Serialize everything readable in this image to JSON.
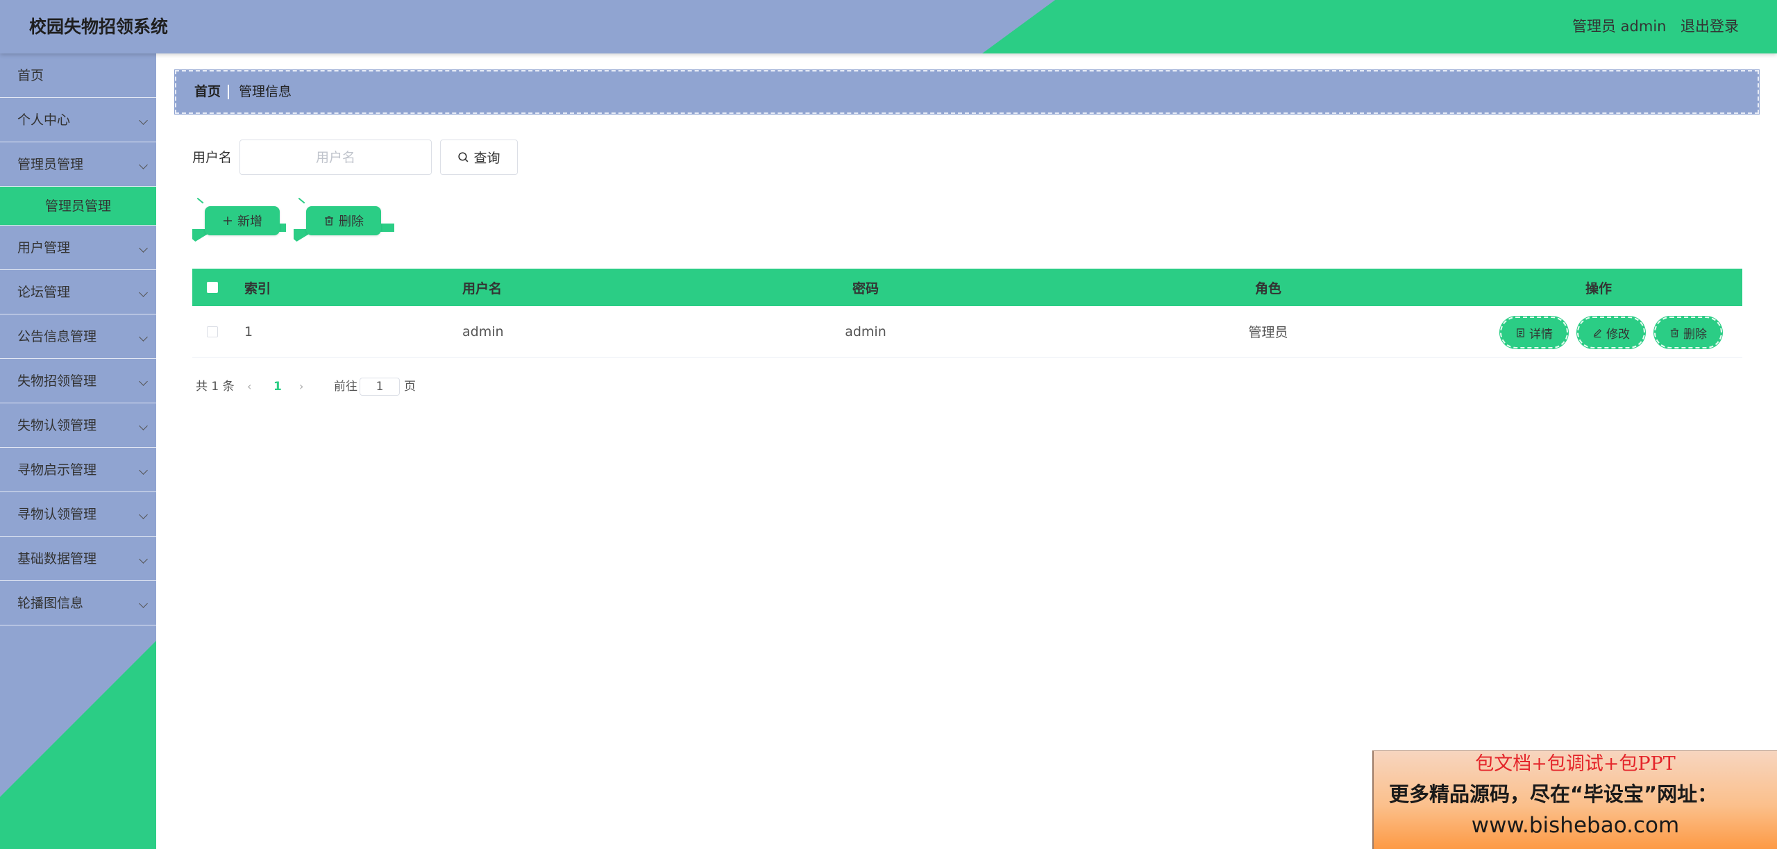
{
  "header": {
    "title": "校园失物招领系统",
    "user_label": "管理员 admin",
    "logout_label": "退出登录"
  },
  "colors": {
    "accent": "#2bcd85",
    "secondary": "#90a4d1"
  },
  "sidebar": {
    "items": [
      {
        "label": "首页",
        "has_children": false
      },
      {
        "label": "个人中心",
        "has_children": true
      },
      {
        "label": "管理员管理",
        "has_children": true,
        "expanded": true,
        "children": [
          "管理员管理"
        ]
      },
      {
        "label": "用户管理",
        "has_children": true
      },
      {
        "label": "论坛管理",
        "has_children": true
      },
      {
        "label": "公告信息管理",
        "has_children": true
      },
      {
        "label": "失物招领管理",
        "has_children": true
      },
      {
        "label": "失物认领管理",
        "has_children": true
      },
      {
        "label": "寻物启示管理",
        "has_children": true
      },
      {
        "label": "寻物认领管理",
        "has_children": true
      },
      {
        "label": "基础数据管理",
        "has_children": true
      },
      {
        "label": "轮播图信息",
        "has_children": true
      }
    ],
    "active_child": "管理员管理"
  },
  "breadcrumb": {
    "home": "首页",
    "current": "管理信息"
  },
  "search": {
    "label": "用户名",
    "placeholder": "用户名",
    "value": "",
    "button_label": "查询",
    "button_icon": "search-icon"
  },
  "actions": {
    "add_label": "新增",
    "add_icon": "plus-icon",
    "delete_label": "删除",
    "delete_icon": "trash-icon"
  },
  "table": {
    "columns": [
      "索引",
      "用户名",
      "密码",
      "角色",
      "操作"
    ],
    "rows": [
      {
        "index": "1",
        "username": "admin",
        "password": "admin",
        "role": "管理员"
      }
    ],
    "row_actions": [
      {
        "label": "详情",
        "icon": "document-icon"
      },
      {
        "label": "修改",
        "icon": "edit-icon"
      },
      {
        "label": "删除",
        "icon": "trash-icon"
      }
    ]
  },
  "pagination": {
    "total_text": "共 1 条",
    "current_page": "1",
    "goto_label": "前往",
    "goto_value": "1",
    "page_suffix": "页"
  },
  "ad_banner": {
    "line1": "包文档+包调试+包PPT",
    "line2": "更多精品源码，尽在“毕设宝”网址：",
    "line3": "www.bishebao.com"
  }
}
